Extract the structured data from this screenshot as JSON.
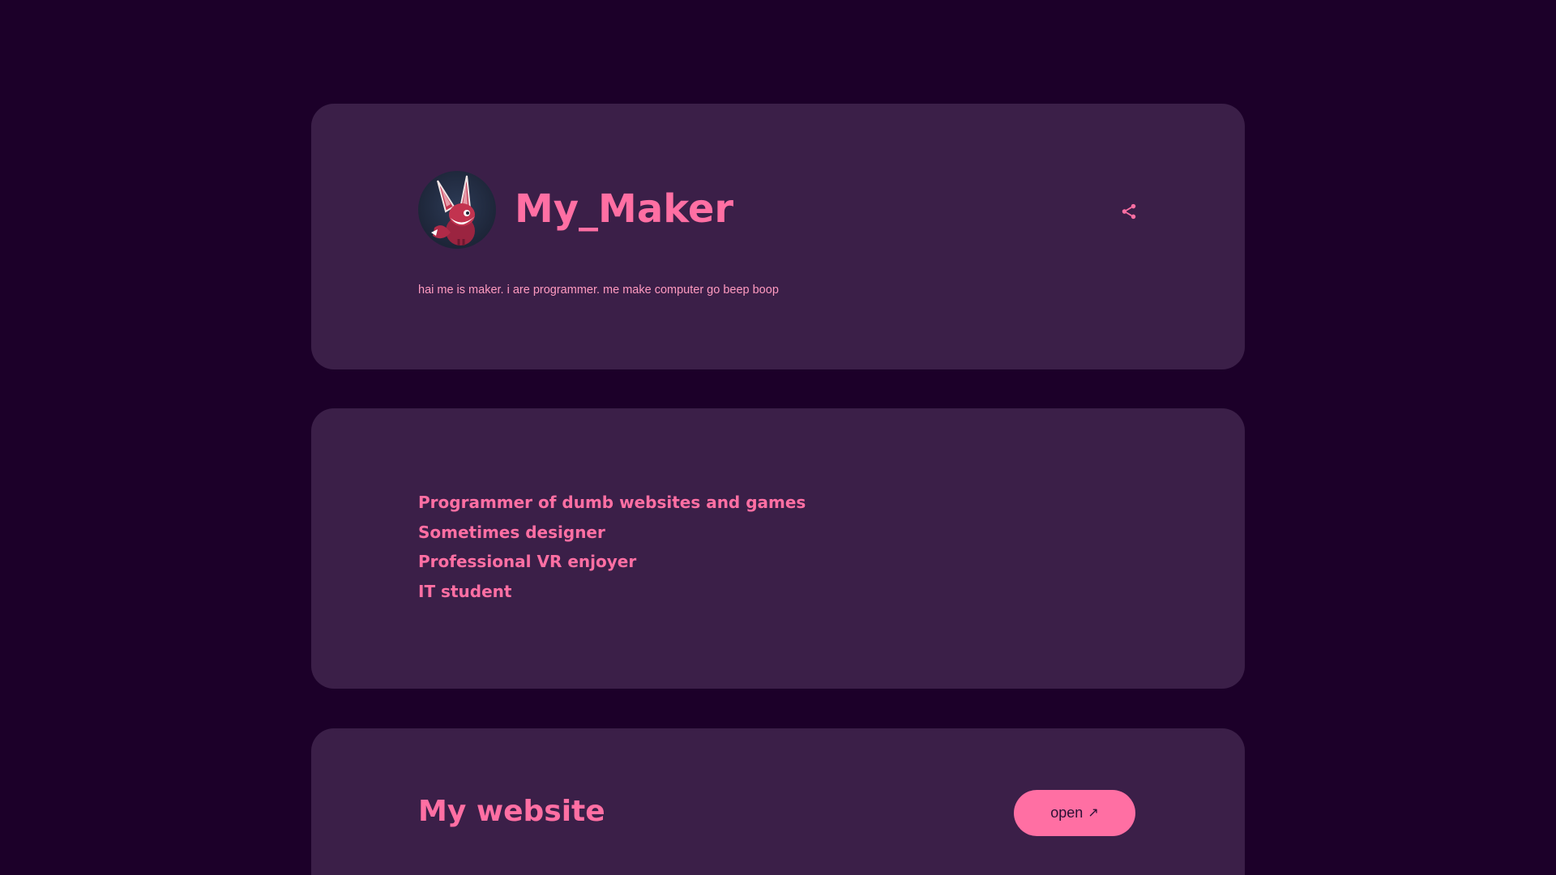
{
  "profile": {
    "name": "My_Maker",
    "bio": "hai me is maker. i are programmer. me make computer go beep boop",
    "avatar_icon": "fox-bunny-avatar",
    "share_icon": "share-icon"
  },
  "roles": [
    "Programmer of dumb websites and games",
    "Sometimes designer",
    "Professional VR enjoyer",
    "IT student"
  ],
  "link": {
    "title": "My website",
    "button_label": "open",
    "button_icon": "↗"
  },
  "colors": {
    "background": "#1c0029",
    "card": "#3b1f48",
    "accent": "#ff6fa3",
    "bio_text": "#ff9bc0",
    "button_text": "#2a0f34"
  }
}
